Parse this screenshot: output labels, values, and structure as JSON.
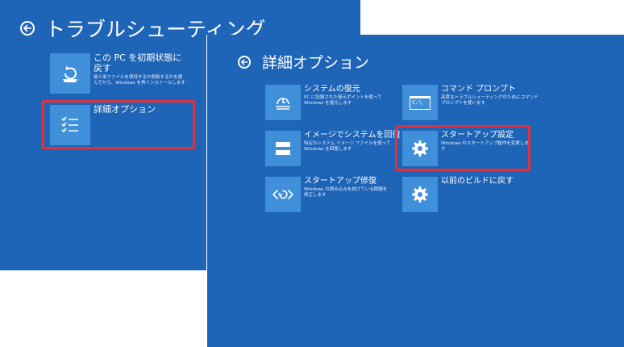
{
  "back_screen": {
    "title": "トラブルシューティング",
    "tiles": [
      {
        "label_lines": [
          "この PC を初期状態に",
          "戻す"
        ],
        "desc_lines": [
          "個人用ファイルを保持するか削除するかを選",
          "んでから、Windows を再インストールします"
        ],
        "icon": "reset-pc-icon"
      },
      {
        "label_lines": [
          "詳細オプション"
        ],
        "desc_lines": [],
        "icon": "checklist-icon"
      }
    ]
  },
  "front_screen": {
    "title": "詳細オプション",
    "tiles": [
      {
        "label": "システムの復元",
        "desc_lines": [
          "PC に記録された復元ポイントを使って",
          "Windows を復元します"
        ],
        "icon": "system-restore-icon"
      },
      {
        "label": "コマンド プロンプト",
        "desc_lines": [
          "高度なトラブルシューティングのためにコマンド",
          "プロンプトを使います"
        ],
        "icon": "command-prompt-icon",
        "icon_text": "C:\\"
      },
      {
        "label": "イメージでシステムを回復",
        "desc_lines": [
          "特定のシステム イメージ ファイルを使って",
          "Windows を回復します"
        ],
        "icon": "system-image-icon"
      },
      {
        "label": "スタートアップ設定",
        "desc_lines": [
          "Windows のスタートアップ動作を変更しま",
          "す"
        ],
        "icon": "gear-icon"
      },
      {
        "label": "スタートアップ修復",
        "desc_lines": [
          "Windows の読み込みを妨げている問題を",
          "修正します"
        ],
        "icon": "startup-repair-icon"
      },
      {
        "label": "以前のビルドに戻す",
        "desc_lines": [],
        "icon": "gear-icon"
      }
    ]
  },
  "highlight_color": "#e0323c"
}
